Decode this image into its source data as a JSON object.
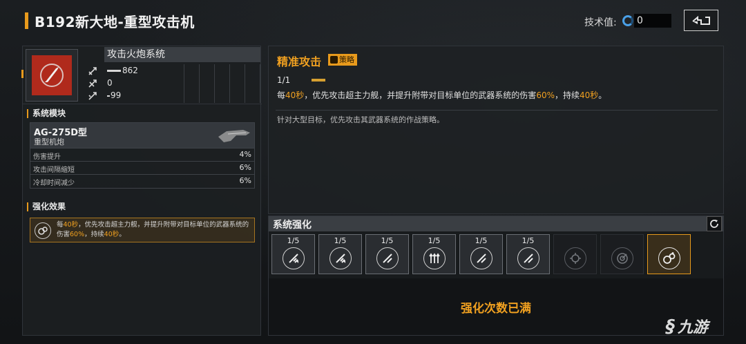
{
  "header": {
    "title": "B192新大地-重型攻击机",
    "tech_label": "技术值:",
    "tech_value": "0"
  },
  "weapon": {
    "name": "攻击火炮系统",
    "stats": [
      {
        "icon": "damage-stat-icon",
        "value": "862"
      },
      {
        "icon": "range-stat-icon",
        "value": "0"
      },
      {
        "icon": "ammo-stat-icon",
        "value": "99"
      }
    ]
  },
  "module_section": {
    "heading": "系统模块",
    "module_name": "AG-275D型",
    "module_type": "重型机炮",
    "rows": [
      {
        "key": "伤害提升",
        "value": "4%"
      },
      {
        "key": "攻击间隔缩短",
        "value": "6%"
      },
      {
        "key": "冷却时间减少",
        "value": "6%"
      }
    ]
  },
  "effect_section": {
    "heading": "强化效果",
    "text_1": "每",
    "text_2": "40秒",
    "text_3": "，优先攻击超主力舰，并提升附带对目标单位的武器系统的伤害",
    "text_4": "60%",
    "text_5": "，持续",
    "text_6": "40秒",
    "text_7": "。"
  },
  "skill": {
    "name": "精准攻击",
    "tag": "策略",
    "level": "1/1",
    "desc_1": "每",
    "desc_2": "40秒",
    "desc_3": "，优先攻击超主力舰，并提升附带对目标单位的武器系统的伤害",
    "desc_4": "60%",
    "desc_5": "，持续",
    "desc_6": "40秒",
    "desc_7": "。",
    "flavor": "针对大型目标，优先攻击其武器系统的作战策略。"
  },
  "upgrade": {
    "title": "系统强化",
    "slots": [
      {
        "level": "1/5",
        "icon": "gun-up-icon",
        "state": "filled"
      },
      {
        "level": "1/5",
        "icon": "gun-up-icon",
        "state": "filled"
      },
      {
        "level": "1/5",
        "icon": "gun-speed-icon",
        "state": "filled"
      },
      {
        "level": "1/5",
        "icon": "triple-arrow-icon",
        "state": "filled"
      },
      {
        "level": "1/5",
        "icon": "gun-speed-icon",
        "state": "filled"
      },
      {
        "level": "1/5",
        "icon": "gun-speed-icon",
        "state": "filled"
      },
      {
        "level": "",
        "icon": "target-icon",
        "state": "locked"
      },
      {
        "level": "",
        "icon": "radar-icon",
        "state": "locked"
      },
      {
        "level": "",
        "icon": "strategy-icon",
        "state": "active"
      }
    ],
    "maxed_text": "强化次数已满"
  },
  "watermark": "九游",
  "colors": {
    "accent": "#f0a020",
    "weapon_red": "#b02a1c",
    "background": "#14171a"
  }
}
